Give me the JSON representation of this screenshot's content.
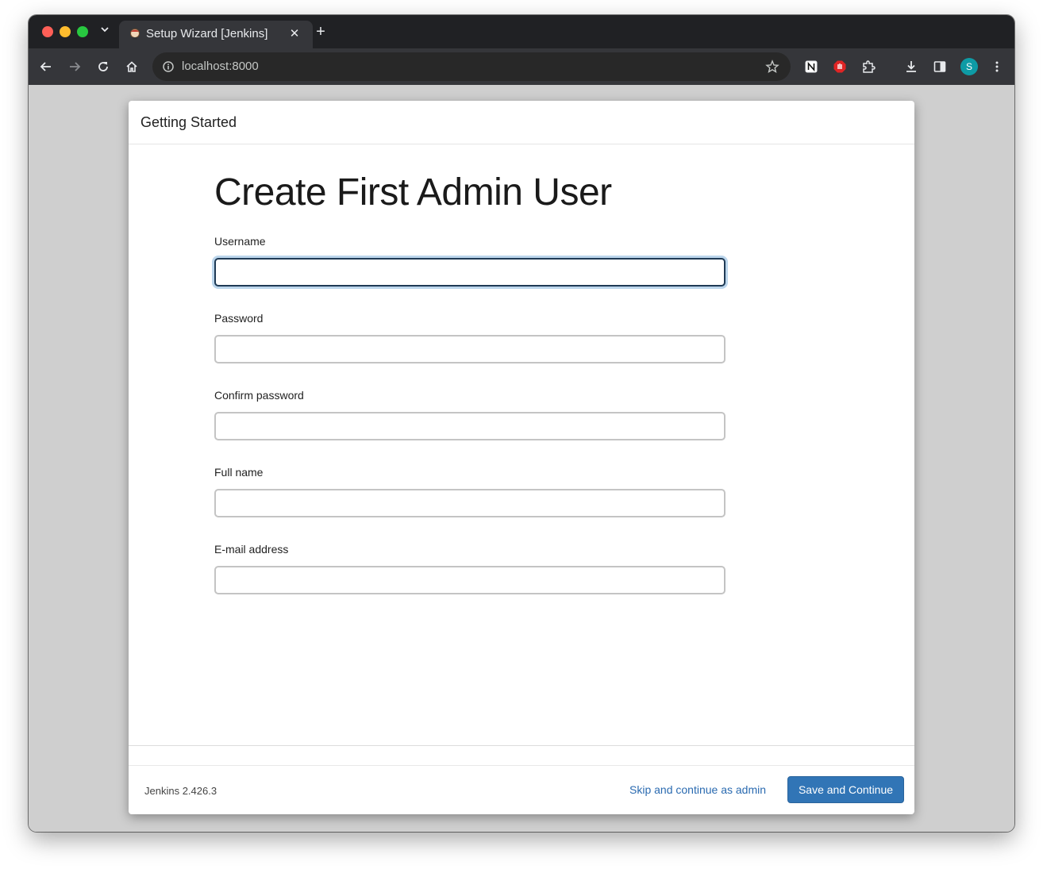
{
  "browser": {
    "tab_title": "Setup Wizard [Jenkins]",
    "url": "localhost:8000",
    "profile_initial": "S",
    "icons": [
      "tab-search-icon",
      "jenkins-favicon-icon",
      "close-icon",
      "plus-icon",
      "back-arrow-icon",
      "forward-arrow-icon",
      "reload-icon",
      "home-icon",
      "info-icon",
      "star-icon",
      "notion-extension-icon",
      "adblock-extension-icon",
      "puzzle-extensions-icon",
      "download-icon",
      "sidebar-icon",
      "kebab-menu-icon"
    ],
    "colors": {
      "tabstrip": "#202124",
      "toolbar": "#35363a",
      "avatar": "#0e9ba5"
    }
  },
  "dialog": {
    "header_title": "Getting Started",
    "heading": "Create First Admin User",
    "fields": {
      "username": {
        "label": "Username",
        "value": ""
      },
      "password": {
        "label": "Password",
        "value": ""
      },
      "confirm_password": {
        "label": "Confirm password",
        "value": ""
      },
      "full_name": {
        "label": "Full name",
        "value": ""
      },
      "email": {
        "label": "E-mail address",
        "value": ""
      }
    },
    "footer": {
      "version": "Jenkins 2.426.3",
      "skip_label": "Skip and continue as admin",
      "save_label": "Save and Continue"
    },
    "colors": {
      "primary_button": "#3175b6",
      "link": "#2a6ab0",
      "focus_ring": "#bcd6ec"
    }
  }
}
